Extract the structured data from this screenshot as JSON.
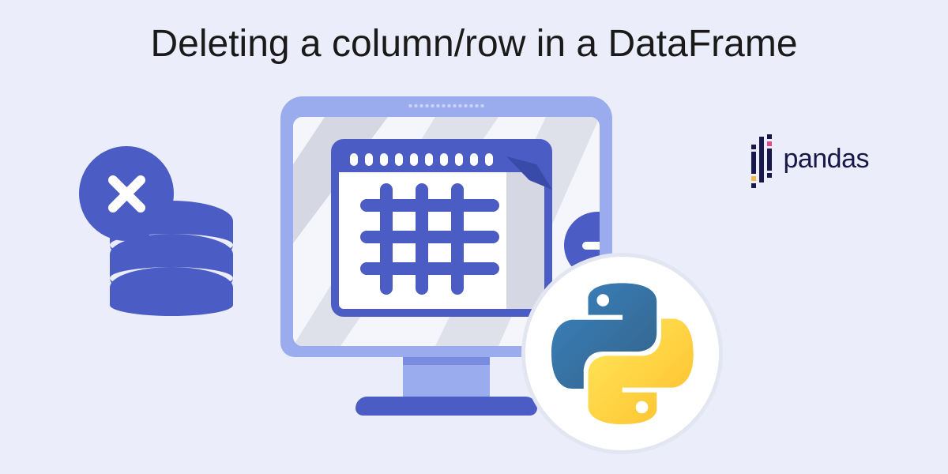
{
  "title": "Deleting a column/row in a DataFrame",
  "pandas_label": "pandas",
  "icons": {
    "delete": "close-icon",
    "remove": "minus-icon",
    "database": "database-icon",
    "monitor": "monitor-icon",
    "table": "table-grid-icon",
    "python": "python-logo-icon",
    "pandas": "pandas-logo-icon"
  },
  "colors": {
    "background": "#EBEEFA",
    "primary": "#4B5CC4",
    "secondary": "#9BACEE",
    "python_blue": "#3B6E8F",
    "python_yellow": "#F4C542",
    "pandas_dark": "#17174A"
  }
}
